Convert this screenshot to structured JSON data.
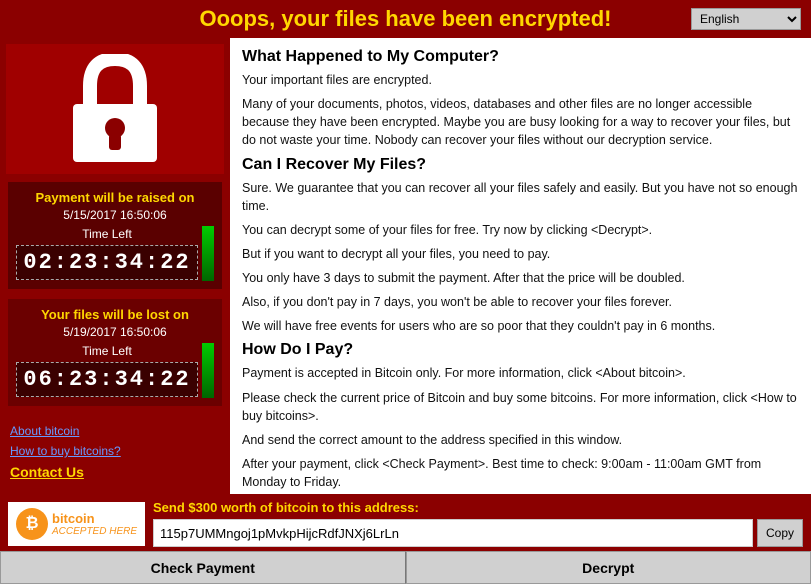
{
  "header": {
    "title": "Ooops, your files have been encrypted!",
    "language": "English"
  },
  "left": {
    "timer1": {
      "label": "Payment will be raised on",
      "date": "5/15/2017 16:50:06",
      "time_left_label": "Time Left",
      "time": "02:23:34:22"
    },
    "timer2": {
      "label": "Your files will be lost on",
      "date": "5/19/2017 16:50:06",
      "time_left_label": "Time Left",
      "time": "06:23:34:22"
    },
    "links": {
      "about_bitcoin": "About bitcoin",
      "how_to_buy": "How to buy bitcoins?",
      "contact_us": "Contact Us"
    }
  },
  "right": {
    "section1": {
      "heading": "What Happened to My Computer?",
      "paragraphs": [
        "Your important files are encrypted.",
        "Many of your documents, photos, videos, databases and other files are no longer accessible because they have been encrypted. Maybe you are busy looking for a way to recover your files, but do not waste your time. Nobody can recover your files without our decryption service."
      ]
    },
    "section2": {
      "heading": "Can I Recover My Files?",
      "paragraphs": [
        "Sure. We guarantee that you can recover all your files safely and easily. But you have not so enough time.",
        "You can decrypt some of your files for free. Try now by clicking <Decrypt>.",
        "But if you want to decrypt all your files, you need to pay.",
        "You only have 3 days to submit the payment. After that the price will be doubled.",
        "Also, if you don't pay in 7 days, you won't be able to recover your files forever.",
        "We will have free events for users who are so poor that they couldn't pay in 6 months."
      ]
    },
    "section3": {
      "heading": "How Do I Pay?",
      "paragraphs": [
        "Payment is accepted in Bitcoin only. For more information, click <About bitcoin>.",
        "Please check the current price of Bitcoin and buy some bitcoins. For more information, click <How to buy bitcoins>.",
        "And send the correct amount to the address specified in this window.",
        "After your payment, click <Check Payment>. Best time to check: 9:00am - 11:00am GMT from Monday to Friday."
      ]
    }
  },
  "bottom": {
    "send_label": "Send $300 worth of bitcoin to this address:",
    "bitcoin_logo_main": "bitcoin",
    "bitcoin_logo_sub": "ACCEPTED HERE",
    "bitcoin_symbol": "₿",
    "address": "115p7UMMngoj1pMvkpHijcRdfJNXj6LrLn",
    "copy_btn": "Copy",
    "check_payment_btn": "Check Payment",
    "decrypt_btn": "Decrypt"
  }
}
